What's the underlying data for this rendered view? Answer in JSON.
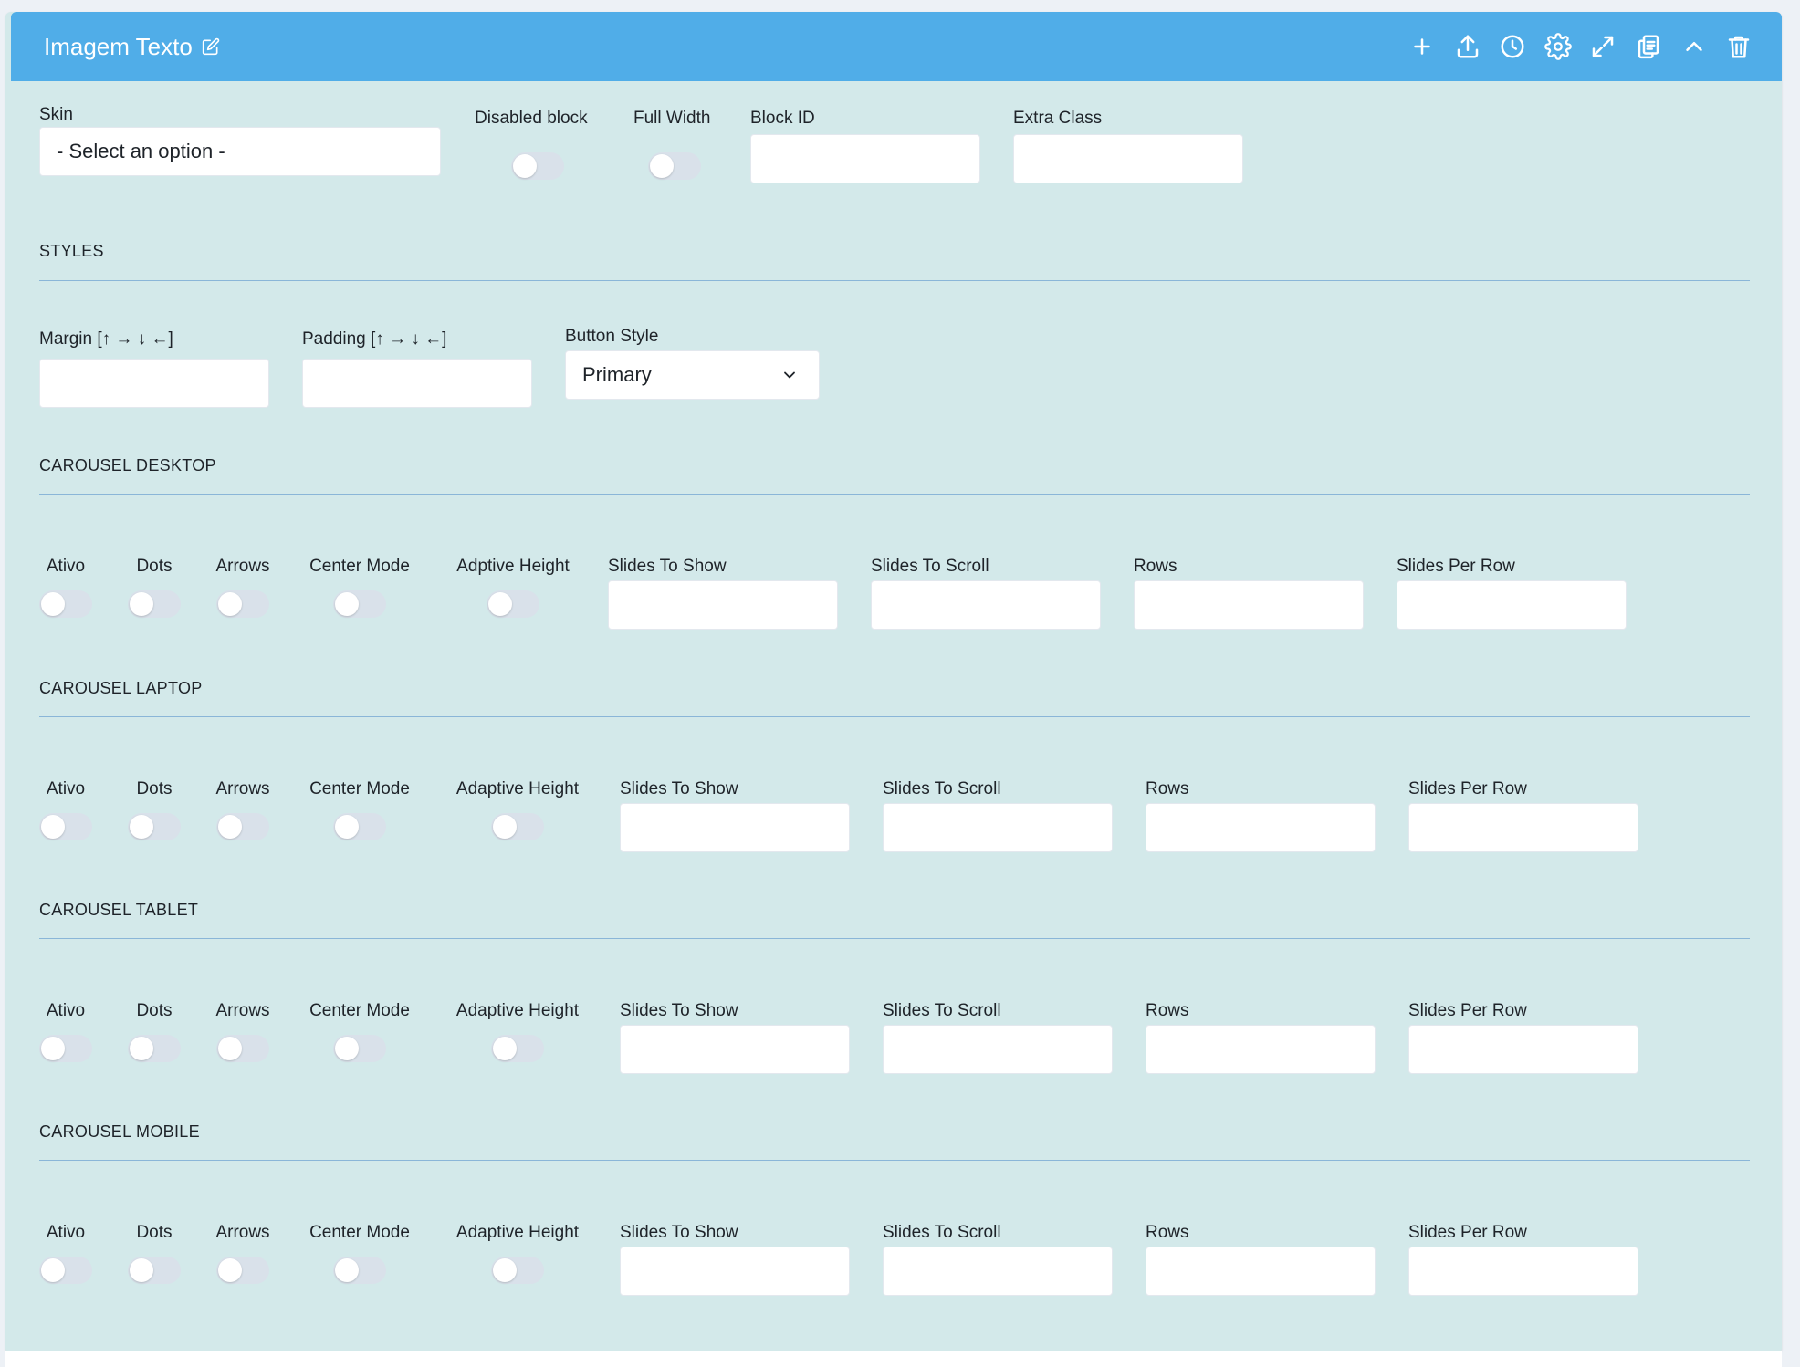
{
  "header": {
    "title": "Imagem Texto"
  },
  "toolbar": {
    "icons": [
      "plus-icon",
      "upload-icon",
      "clock-icon",
      "gear-icon",
      "expand-icon",
      "copy-icon",
      "chevron-up-icon",
      "trash-icon"
    ]
  },
  "general": {
    "skin_label": "Skin",
    "skin_value": "- Select an option -",
    "disabled_label": "Disabled block",
    "fullwidth_label": "Full Width",
    "blockid_label": "Block ID",
    "extraclass_label": "Extra Class"
  },
  "styles": {
    "title": "STYLES",
    "margin_label": "Margin [↑ → ↓ ←]",
    "padding_label": "Padding [↑ → ↓ ←]",
    "button_style_label": "Button Style",
    "button_style_value": "Primary"
  },
  "carousels": [
    {
      "title": "CAROUSEL DESKTOP",
      "ativo": "Ativo",
      "dots": "Dots",
      "arrows": "Arrows",
      "center": "Center Mode",
      "adaptive": "Adptive Height",
      "show": "Slides To Show",
      "scroll": "Slides To Scroll",
      "rows": "Rows",
      "perrow": "Slides Per Row"
    },
    {
      "title": "CAROUSEL LAPTOP",
      "ativo": "Ativo",
      "dots": "Dots",
      "arrows": "Arrows",
      "center": "Center Mode",
      "adaptive": "Adaptive Height",
      "show": "Slides To Show",
      "scroll": "Slides To Scroll",
      "rows": "Rows",
      "perrow": "Slides Per Row"
    },
    {
      "title": "CAROUSEL TABLET",
      "ativo": "Ativo",
      "dots": "Dots",
      "arrows": "Arrows",
      "center": "Center Mode",
      "adaptive": "Adaptive Height",
      "show": "Slides To Show",
      "scroll": "Slides To Scroll",
      "rows": "Rows",
      "perrow": "Slides Per Row"
    },
    {
      "title": "CAROUSEL MOBILE",
      "ativo": "Ativo",
      "dots": "Dots",
      "arrows": "Arrows",
      "center": "Center Mode",
      "adaptive": "Adaptive Height",
      "show": "Slides To Show",
      "scroll": "Slides To Scroll",
      "rows": "Rows",
      "perrow": "Slides Per Row"
    }
  ],
  "colors": {
    "header": "#50ade8",
    "panel": "#d3e9ea",
    "divider": "#8ab6d8",
    "toggle_track": "#d9e1ea"
  }
}
